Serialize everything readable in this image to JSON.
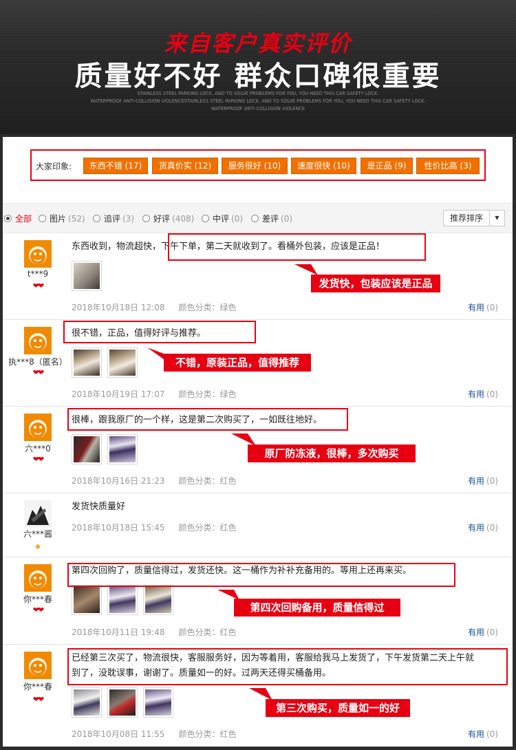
{
  "banner": {
    "title": "来自客户真实评价",
    "headline": "质量好不好  群众口碑很重要",
    "sub1": "STAINLESS STEEL PARKING LOCK, AND TO SOLVE PROBLEMS FOR YOU, YOU NEED THIS CAR SAFETY LOCK.",
    "sub2": "WATERPROOF ANTI-COLLISION VIOLENCESTAINLESS STEEL PARKING LOCK, AND TO SOLVE PROBLEMS FOR YOU, YOU NEED THIS CAR SAFETY LOCK.",
    "sub3": "WATERPROOF ANTI-COLLISION VIOLENCE"
  },
  "impressions": {
    "label": "大家印象:",
    "tags": [
      {
        "label": "东西不错 (17)"
      },
      {
        "label": "货真价实 (12)"
      },
      {
        "label": "服务很好 (10)"
      },
      {
        "label": "速度很快 (10)"
      },
      {
        "label": "是正品 (9)"
      },
      {
        "label": "性价比高 (3)"
      }
    ]
  },
  "filters": {
    "all": {
      "label": "全部"
    },
    "pics": {
      "label": "图片",
      "count": "(52)"
    },
    "append": {
      "label": "追评",
      "count": "(3)"
    },
    "good": {
      "label": "好评",
      "count": "(408)"
    },
    "mid": {
      "label": "中评",
      "count": "(0)"
    },
    "bad": {
      "label": "差评",
      "count": "(0)"
    },
    "sort_label": "推荐排序",
    "sort_arrow": "▼"
  },
  "useful_label": "有用",
  "reviews": [
    {
      "user": "t***9",
      "text": "东西收到，物流超快，下午下单，第二天就收到了。看桶外包装，应该是正品！",
      "date": "2018年10月18日 12:08",
      "color": "颜色分类：绿色",
      "useful": "(0)",
      "callout": "发货快，包装应该是正品"
    },
    {
      "user": "执***8（匿名）",
      "text": "很不错，正品，值得好评与推荐。",
      "date": "2018年10月19日 17:07",
      "color": "颜色分类：绿色",
      "useful": "(0)",
      "callout": "不错，原装正品，值得推荐"
    },
    {
      "user": "六***0",
      "text": "很棒，跟我原厂的一个样，这是第二次购买了，一如既往地好。",
      "date": "2018年10月16日 21:23",
      "color": "颜色分类：红色",
      "useful": "(0)",
      "callout": "原厂防冻液，很棒，多次购买"
    },
    {
      "user": "六***酱",
      "text": "发货快质量好",
      "date": "2018年10月18日 15:45",
      "color": "颜色分类：红色",
      "useful": "(0)"
    },
    {
      "user": "你***春",
      "text": "第四次回购了，质量信得过，发货还快。这一桶作为补补充备用的。等用上还再来买。",
      "date": "2018年10月11日 19:48",
      "color": "颜色分类：红色",
      "useful": "(0)",
      "callout": "第四次回购备用，质量信得过"
    },
    {
      "user": "你***春",
      "text1": "已经第三次买了，物流很快，客服服务好，因为等着用，客服给我马上发货了，下午发货第二天上午就",
      "text2": "到了，没耽误事，谢谢了。质量如一的好。过两天还得买桶备用。",
      "date": "2018年10月08日 11:55",
      "color": "颜色分类：红色",
      "useful": "(0)",
      "callout": "第三次购买，质量如一的好"
    }
  ],
  "colors": {
    "accent_red": "#e60012",
    "tag_orange": "#f07000",
    "link_blue": "#1a4f99",
    "avatar_orange": "#f08a00"
  }
}
